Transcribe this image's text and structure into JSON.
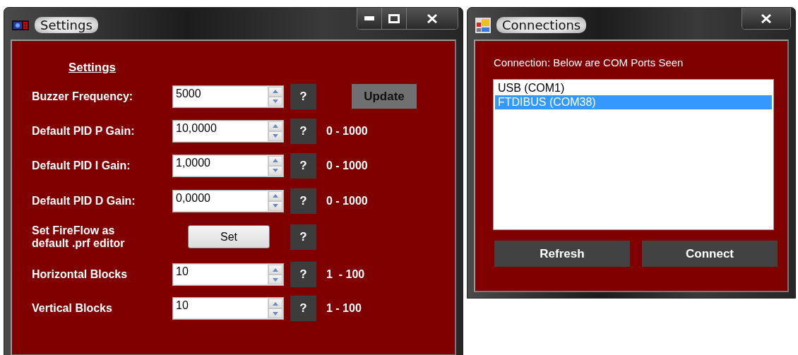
{
  "settings_window": {
    "title": "Settings",
    "heading": "Settings",
    "update_button": {
      "label": "Update",
      "disabled": true
    },
    "rows": [
      {
        "kind": "spin",
        "label": "Buzzer Frequency:",
        "value": "5000",
        "help": "?"
      },
      {
        "kind": "spin",
        "label": "Default PID P Gain:",
        "value": "10,0000",
        "help": "?",
        "range": "0 - 1000"
      },
      {
        "kind": "spin",
        "label": "Default PID I Gain:",
        "value": "1,0000",
        "help": "?",
        "range": "0 - 1000"
      },
      {
        "kind": "spin",
        "label": "Default PID D Gain:",
        "value": "0,0000",
        "help": "?",
        "range": "0 - 1000"
      },
      {
        "kind": "button",
        "label": "Set FireFlow as default .prf editor",
        "button": "Set",
        "help": "?"
      },
      {
        "kind": "spin",
        "label": "Horizontal Blocks",
        "value": "10",
        "help": "?",
        "range": "1  - 100"
      },
      {
        "kind": "spin",
        "label": "Vertical Blocks",
        "value": "10",
        "help": "?",
        "range": "1 - 100"
      }
    ]
  },
  "connections_window": {
    "title": "Connections",
    "caption": "Connection: Below are COM Ports Seen",
    "ports": [
      {
        "label": "USB (COM1)",
        "selected": false
      },
      {
        "label": "FTDIBUS (COM38)",
        "selected": true
      }
    ],
    "buttons": [
      "Refresh",
      "Connect"
    ]
  }
}
